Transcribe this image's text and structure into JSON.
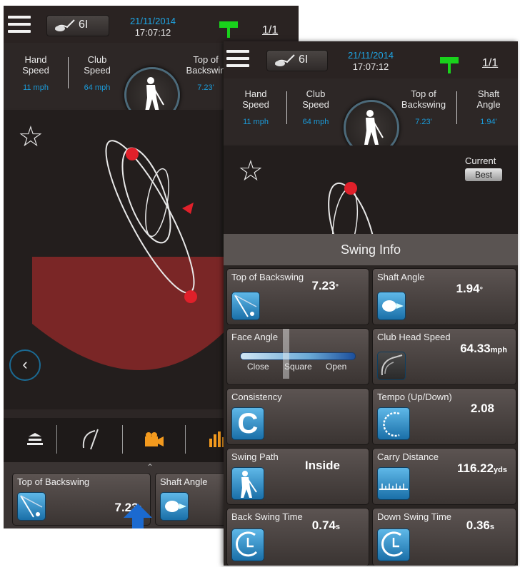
{
  "back_screen": {
    "club_label": "6I",
    "date": "21/11/2014",
    "time": "17:07:12",
    "page": "1/1",
    "metrics": [
      {
        "label_1": "Hand",
        "label_2": "Speed",
        "value": "11 mph"
      },
      {
        "label_1": "Club",
        "label_2": "Speed",
        "value": "64 mph"
      },
      {
        "label_1": "Top of",
        "label_2": "Backswin",
        "value": "7.23'"
      }
    ],
    "bottom_cards": [
      {
        "title": "Top of Backswing",
        "value": "7.23",
        "unit": "°"
      },
      {
        "title": "Shaft Angle",
        "value": "",
        "unit": ""
      }
    ]
  },
  "front_screen": {
    "club_label": "6I",
    "date": "21/11/2014",
    "time": "17:07:12",
    "page": "1/1",
    "metrics": [
      {
        "label_1": "Hand",
        "label_2": "Speed",
        "value": "11 mph"
      },
      {
        "label_1": "Club",
        "label_2": "Speed",
        "value": "64 mph"
      },
      {
        "label_1": "Top of",
        "label_2": "Backswing",
        "value": "7.23'"
      },
      {
        "label_1": "Shaft",
        "label_2": "Angle",
        "value": "1.94'"
      }
    ],
    "current_label": "Current",
    "best_label": "Best",
    "swing_info": {
      "title": "Swing Info",
      "cards": [
        {
          "title": "Top of Backswing",
          "value": "7.23",
          "unit": "°"
        },
        {
          "title": "Shaft Angle",
          "value": "1.94",
          "unit": "°"
        },
        {
          "title": "Face Angle",
          "value": "",
          "unit": "",
          "scale": [
            "Close",
            "Square",
            "Open"
          ]
        },
        {
          "title": "Club Head Speed",
          "value": "64.33",
          "unit": "mph"
        },
        {
          "title": "Consistency",
          "value": "",
          "unit": ""
        },
        {
          "title": "Tempo (Up/Down)",
          "value": "2.08",
          "unit": ""
        },
        {
          "title": "Swing Path",
          "value": "Inside",
          "unit": ""
        },
        {
          "title": "Carry Distance",
          "value": "116.22",
          "unit": "yds"
        },
        {
          "title": "Back Swing Time",
          "value": "0.74",
          "unit": "s"
        },
        {
          "title": "Down Swing Time",
          "value": "0.36",
          "unit": "s"
        }
      ]
    }
  },
  "colors": {
    "accent_blue": "#1ea6e6",
    "flag_green": "#19d21c",
    "orange": "#f39a1e",
    "swing_red": "#7a2626"
  }
}
